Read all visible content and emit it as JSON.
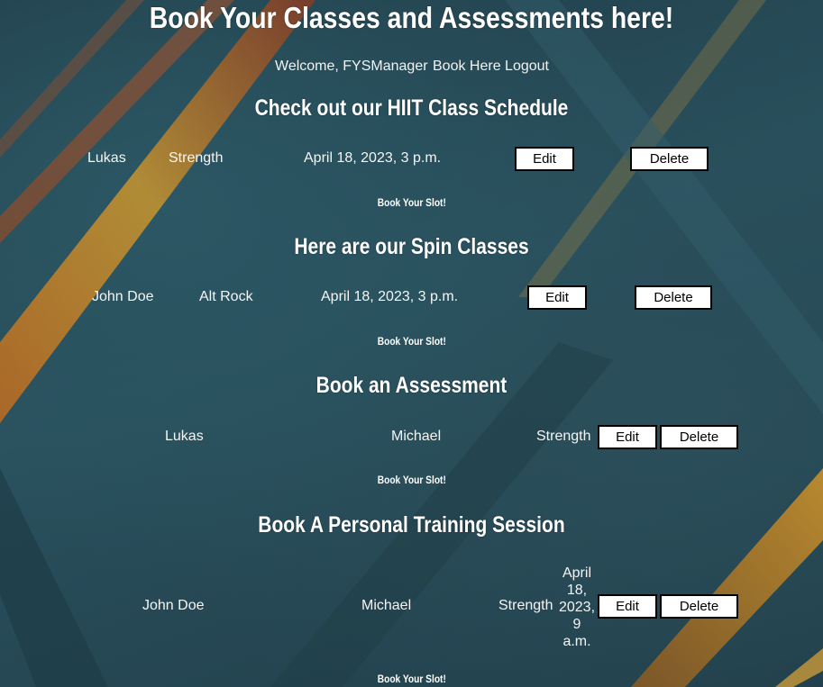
{
  "header": {
    "title": "Book Your Classes and Assessments here!"
  },
  "nav": {
    "welcome": "Welcome, FYSManager",
    "book_link": "Book Here",
    "logout_link": "Logout"
  },
  "sections": [
    {
      "title": "Check out our HIIT Class Schedule",
      "row": {
        "instructor": "Lukas",
        "type": "Strength",
        "datetime": "April 18, 2023, 3 p.m.",
        "edit": "Edit",
        "delete": "Delete"
      },
      "book_label": "Book Your Slot!"
    },
    {
      "title": "Here are our Spin Classes",
      "row": {
        "instructor": "John Doe",
        "type": "Alt Rock",
        "datetime": "April 18, 2023, 3 p.m.",
        "edit": "Edit",
        "delete": "Delete"
      },
      "book_label": "Book Your Slot!"
    },
    {
      "title": "Book an Assessment",
      "row": {
        "client": "Lukas",
        "trainer": "Michael",
        "type": "Strength",
        "edit": "Edit",
        "delete": "Delete"
      },
      "book_label": "Book Your Slot!"
    },
    {
      "title": "Book A Personal Training Session",
      "row": {
        "client": "John Doe",
        "trainer": "Michael",
        "type": "Strength",
        "datetime_lines": [
          "April",
          "18,",
          "2023,",
          "9",
          "a.m."
        ],
        "edit": "Edit",
        "delete": "Delete"
      },
      "book_label": "Book Your Slot!"
    }
  ],
  "colors": {
    "background": "#23444f",
    "stripe_orange": "#c07a2a",
    "stripe_red": "#a04a2a",
    "button_bg": "#ffffff",
    "button_border": "#000000"
  }
}
